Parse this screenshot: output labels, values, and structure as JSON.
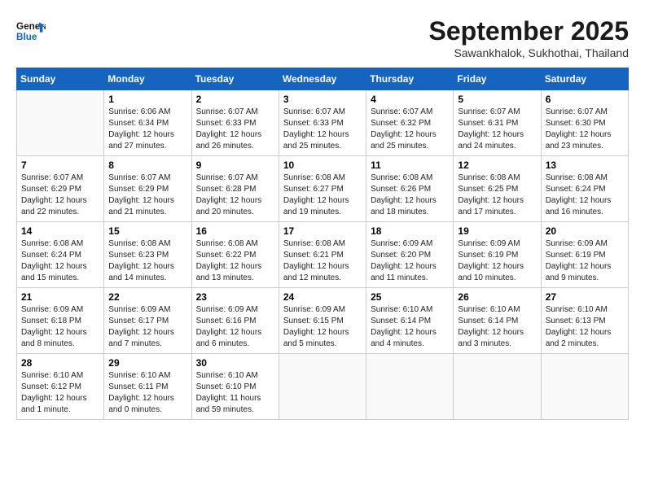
{
  "header": {
    "logo_line1": "General",
    "logo_line2": "Blue",
    "month_title": "September 2025",
    "location": "Sawankhalok, Sukhothai, Thailand"
  },
  "days_of_week": [
    "Sunday",
    "Monday",
    "Tuesday",
    "Wednesday",
    "Thursday",
    "Friday",
    "Saturday"
  ],
  "weeks": [
    [
      {
        "day": "",
        "info": ""
      },
      {
        "day": "1",
        "info": "Sunrise: 6:06 AM\nSunset: 6:34 PM\nDaylight: 12 hours\nand 27 minutes."
      },
      {
        "day": "2",
        "info": "Sunrise: 6:07 AM\nSunset: 6:33 PM\nDaylight: 12 hours\nand 26 minutes."
      },
      {
        "day": "3",
        "info": "Sunrise: 6:07 AM\nSunset: 6:33 PM\nDaylight: 12 hours\nand 25 minutes."
      },
      {
        "day": "4",
        "info": "Sunrise: 6:07 AM\nSunset: 6:32 PM\nDaylight: 12 hours\nand 25 minutes."
      },
      {
        "day": "5",
        "info": "Sunrise: 6:07 AM\nSunset: 6:31 PM\nDaylight: 12 hours\nand 24 minutes."
      },
      {
        "day": "6",
        "info": "Sunrise: 6:07 AM\nSunset: 6:30 PM\nDaylight: 12 hours\nand 23 minutes."
      }
    ],
    [
      {
        "day": "7",
        "info": "Sunrise: 6:07 AM\nSunset: 6:29 PM\nDaylight: 12 hours\nand 22 minutes."
      },
      {
        "day": "8",
        "info": "Sunrise: 6:07 AM\nSunset: 6:29 PM\nDaylight: 12 hours\nand 21 minutes."
      },
      {
        "day": "9",
        "info": "Sunrise: 6:07 AM\nSunset: 6:28 PM\nDaylight: 12 hours\nand 20 minutes."
      },
      {
        "day": "10",
        "info": "Sunrise: 6:08 AM\nSunset: 6:27 PM\nDaylight: 12 hours\nand 19 minutes."
      },
      {
        "day": "11",
        "info": "Sunrise: 6:08 AM\nSunset: 6:26 PM\nDaylight: 12 hours\nand 18 minutes."
      },
      {
        "day": "12",
        "info": "Sunrise: 6:08 AM\nSunset: 6:25 PM\nDaylight: 12 hours\nand 17 minutes."
      },
      {
        "day": "13",
        "info": "Sunrise: 6:08 AM\nSunset: 6:24 PM\nDaylight: 12 hours\nand 16 minutes."
      }
    ],
    [
      {
        "day": "14",
        "info": "Sunrise: 6:08 AM\nSunset: 6:24 PM\nDaylight: 12 hours\nand 15 minutes."
      },
      {
        "day": "15",
        "info": "Sunrise: 6:08 AM\nSunset: 6:23 PM\nDaylight: 12 hours\nand 14 minutes."
      },
      {
        "day": "16",
        "info": "Sunrise: 6:08 AM\nSunset: 6:22 PM\nDaylight: 12 hours\nand 13 minutes."
      },
      {
        "day": "17",
        "info": "Sunrise: 6:08 AM\nSunset: 6:21 PM\nDaylight: 12 hours\nand 12 minutes."
      },
      {
        "day": "18",
        "info": "Sunrise: 6:09 AM\nSunset: 6:20 PM\nDaylight: 12 hours\nand 11 minutes."
      },
      {
        "day": "19",
        "info": "Sunrise: 6:09 AM\nSunset: 6:19 PM\nDaylight: 12 hours\nand 10 minutes."
      },
      {
        "day": "20",
        "info": "Sunrise: 6:09 AM\nSunset: 6:19 PM\nDaylight: 12 hours\nand 9 minutes."
      }
    ],
    [
      {
        "day": "21",
        "info": "Sunrise: 6:09 AM\nSunset: 6:18 PM\nDaylight: 12 hours\nand 8 minutes."
      },
      {
        "day": "22",
        "info": "Sunrise: 6:09 AM\nSunset: 6:17 PM\nDaylight: 12 hours\nand 7 minutes."
      },
      {
        "day": "23",
        "info": "Sunrise: 6:09 AM\nSunset: 6:16 PM\nDaylight: 12 hours\nand 6 minutes."
      },
      {
        "day": "24",
        "info": "Sunrise: 6:09 AM\nSunset: 6:15 PM\nDaylight: 12 hours\nand 5 minutes."
      },
      {
        "day": "25",
        "info": "Sunrise: 6:10 AM\nSunset: 6:14 PM\nDaylight: 12 hours\nand 4 minutes."
      },
      {
        "day": "26",
        "info": "Sunrise: 6:10 AM\nSunset: 6:14 PM\nDaylight: 12 hours\nand 3 minutes."
      },
      {
        "day": "27",
        "info": "Sunrise: 6:10 AM\nSunset: 6:13 PM\nDaylight: 12 hours\nand 2 minutes."
      }
    ],
    [
      {
        "day": "28",
        "info": "Sunrise: 6:10 AM\nSunset: 6:12 PM\nDaylight: 12 hours\nand 1 minute."
      },
      {
        "day": "29",
        "info": "Sunrise: 6:10 AM\nSunset: 6:11 PM\nDaylight: 12 hours\nand 0 minutes."
      },
      {
        "day": "30",
        "info": "Sunrise: 6:10 AM\nSunset: 6:10 PM\nDaylight: 11 hours\nand 59 minutes."
      },
      {
        "day": "",
        "info": ""
      },
      {
        "day": "",
        "info": ""
      },
      {
        "day": "",
        "info": ""
      },
      {
        "day": "",
        "info": ""
      }
    ]
  ]
}
